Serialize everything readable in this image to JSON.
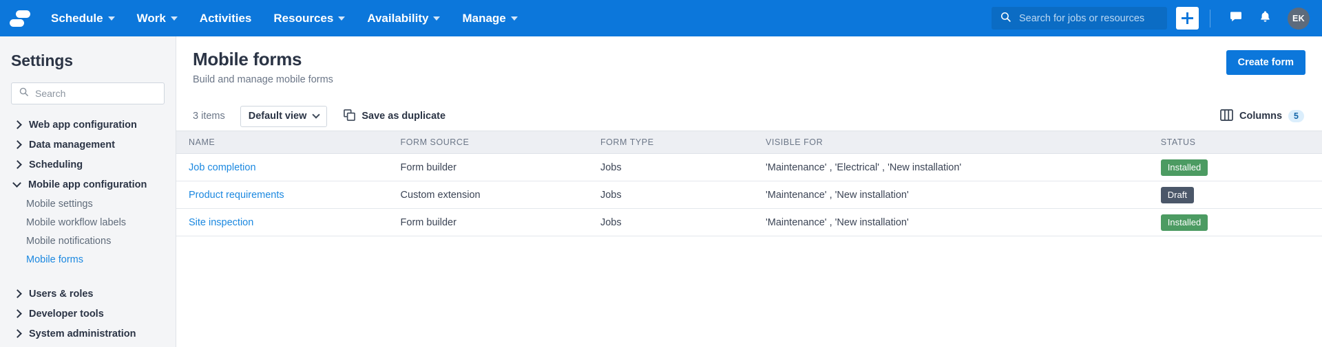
{
  "topnav": {
    "logo_name": "skedulo-logo",
    "background": "#0c77db",
    "items": [
      {
        "label": "Schedule",
        "has_caret": true
      },
      {
        "label": "Work",
        "has_caret": true
      },
      {
        "label": "Activities",
        "has_caret": false
      },
      {
        "label": "Resources",
        "has_caret": true
      },
      {
        "label": "Availability",
        "has_caret": true
      },
      {
        "label": "Manage",
        "has_caret": true
      }
    ],
    "search": {
      "placeholder": "Search for jobs or resources",
      "value": ""
    },
    "create_icon": "plus-icon",
    "chat_icon": "chat-bubble-icon",
    "bell_icon": "bell-icon",
    "avatar_initials": "EK"
  },
  "sidebar": {
    "title": "Settings",
    "search": {
      "placeholder": "Search",
      "value": ""
    },
    "items": [
      {
        "label": "Web app configuration",
        "type": "group",
        "expanded": false
      },
      {
        "label": "Data management",
        "type": "group",
        "expanded": false
      },
      {
        "label": "Scheduling",
        "type": "group",
        "expanded": false
      },
      {
        "label": "Mobile app configuration",
        "type": "group",
        "expanded": true
      },
      {
        "label": "Mobile settings",
        "type": "sub",
        "active": false
      },
      {
        "label": "Mobile workflow labels",
        "type": "sub",
        "active": false
      },
      {
        "label": "Mobile notifications",
        "type": "sub",
        "active": false
      },
      {
        "label": "Mobile forms",
        "type": "sub",
        "active": true
      },
      {
        "label": "Users & roles",
        "type": "group",
        "expanded": false
      },
      {
        "label": "Developer tools",
        "type": "group",
        "expanded": false
      },
      {
        "label": "System administration",
        "type": "group",
        "expanded": false
      }
    ],
    "active_item": "Mobile forms"
  },
  "page": {
    "title": "Mobile forms",
    "subtitle": "Build and manage mobile forms",
    "create_button": "Create form"
  },
  "toolbar": {
    "items_count": "3 items",
    "view_select": "Default view",
    "save_duplicate": "Save as duplicate",
    "duplicate_icon": "copy-icon",
    "columns_label": "Columns",
    "columns_count": "5",
    "columns_icon": "columns-icon"
  },
  "table": {
    "columns": [
      "NAME",
      "FORM SOURCE",
      "FORM TYPE",
      "VISIBLE FOR",
      "STATUS"
    ],
    "rows": [
      {
        "name": "Job completion",
        "form_source": "Form builder",
        "form_type": "Jobs",
        "visible_for": "'Maintenance' , 'Electrical' , 'New installation'",
        "status": "Installed",
        "status_kind": "installed"
      },
      {
        "name": "Product requirements",
        "form_source": "Custom extension",
        "form_type": "Jobs",
        "visible_for": "'Maintenance' , 'New installation'",
        "status": "Draft",
        "status_kind": "draft"
      },
      {
        "name": "Site inspection",
        "form_source": "Form builder",
        "form_type": "Jobs",
        "visible_for": "'Maintenance' , 'New installation'",
        "status": "Installed",
        "status_kind": "installed"
      }
    ]
  },
  "colors": {
    "brand_blue": "#0c77db",
    "link_blue": "#1b88e0",
    "installed_green": "#4c9b62",
    "draft_slate": "#4b5769",
    "sidebar_bg": "#f4f5f7",
    "header_row_bg": "#edeff3"
  }
}
